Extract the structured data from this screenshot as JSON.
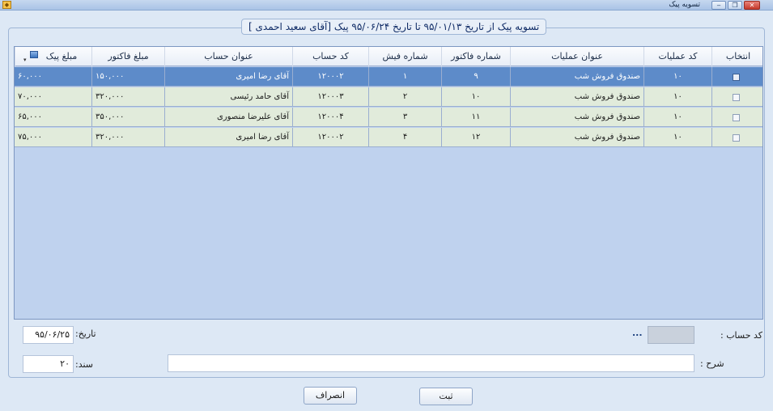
{
  "window": {
    "title": "تسویه پیک"
  },
  "group": {
    "title": "تسویه پیک  از تاریخ ۹۵/۰۱/۱۳  تا تاریخ ۹۵/۰۶/۲۴  پیک [آقای سعید احمدی ]"
  },
  "grid": {
    "columns": {
      "select": "انتخاب",
      "op_code": "کد عملیات",
      "op_title": "عنوان عملیات",
      "invoice_no": "شماره فاکتور",
      "receipt_no": "شماره فیش",
      "account_code": "کد حساب",
      "account_title": "عنوان حساب",
      "invoice_amount": "مبلغ فاکتور",
      "courier_amount": "مبلغ پیک"
    },
    "rows": [
      {
        "op_code": "۱۰",
        "op_title": "صندوق فروش شب",
        "invoice_no": "۹",
        "receipt_no": "۱",
        "account_code": "۱۲۰۰۰۲",
        "account_title": "آقای رضا امیری",
        "invoice_amount": "۱۵۰,۰۰۰",
        "courier_amount": "۶۰,۰۰۰"
      },
      {
        "op_code": "۱۰",
        "op_title": "صندوق فروش شب",
        "invoice_no": "۱۰",
        "receipt_no": "۲",
        "account_code": "۱۲۰۰۰۳",
        "account_title": "آقای حامد رئیسی",
        "invoice_amount": "۳۲۰,۰۰۰",
        "courier_amount": "۷۰,۰۰۰"
      },
      {
        "op_code": "۱۰",
        "op_title": "صندوق فروش شب",
        "invoice_no": "۱۱",
        "receipt_no": "۳",
        "account_code": "۱۲۰۰۰۴",
        "account_title": "آقای علیرضا منصوری",
        "invoice_amount": "۳۵۰,۰۰۰",
        "courier_amount": "۶۵,۰۰۰"
      },
      {
        "op_code": "۱۰",
        "op_title": "صندوق فروش شب",
        "invoice_no": "۱۲",
        "receipt_no": "۴",
        "account_code": "۱۲۰۰۰۲",
        "account_title": "آقای رضا امیری",
        "invoice_amount": "۳۲۰,۰۰۰",
        "courier_amount": "۷۵,۰۰۰"
      }
    ]
  },
  "form": {
    "account_label": "کد حساب :",
    "account_value": "",
    "account_lookup": "...",
    "date_label": "تاریخ:",
    "date_value": "۹۵/۰۶/۲۵",
    "description_label": "شرح :",
    "description_value": "",
    "document_label": "سند:",
    "document_value": "۲۰"
  },
  "buttons": {
    "submit": "ثبت",
    "cancel": "انصراف"
  },
  "colors": {
    "selected_row": "#5d8bc9",
    "row": "#e1ebdb",
    "grid_bg": "#bfd2ee"
  }
}
